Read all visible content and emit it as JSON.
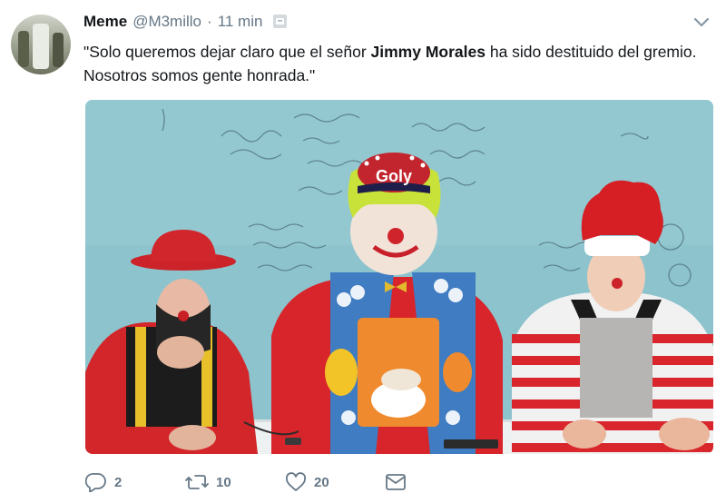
{
  "tweet": {
    "author_name": "Meme",
    "author_handle": "@M3millo",
    "separator": "·",
    "time": "11 min",
    "text_before": "\"Solo queremos dejar claro que el señor ",
    "text_bold": "Jimmy Morales",
    "text_after": " ha sido destituido del gremio. Nosotros somos gente honrada.\""
  },
  "actions": {
    "reply_count": "2",
    "retweet_count": "10",
    "like_count": "20"
  },
  "media": {
    "cap_text": "Goly"
  },
  "icons": {
    "chevron": "chevron-down-icon",
    "reply": "reply-icon",
    "retweet": "retweet-icon",
    "like": "heart-icon",
    "message": "envelope-icon"
  },
  "colors": {
    "text": "#14171a",
    "muted": "#657786",
    "icon": "#657786"
  }
}
